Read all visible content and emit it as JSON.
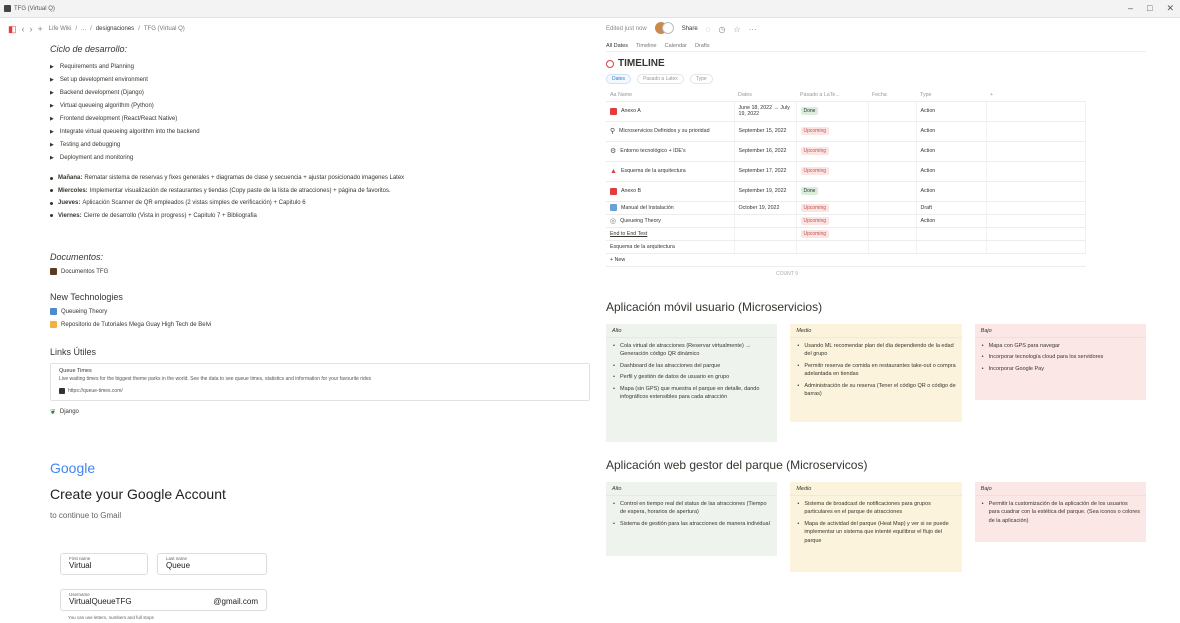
{
  "window": {
    "title": "TFG (Virtual Q)"
  },
  "topbar": {
    "breadcrumb": [
      "Life Wiki",
      "...",
      "designaciones",
      "TFG (Virtual Q)"
    ],
    "edited": "Edited just now",
    "share": "Share"
  },
  "left": {
    "ciclo_title": "Ciclo de desarrollo:",
    "ciclo_items": [
      "Requirements and Planning",
      "Set up development environment",
      "Backend development (Django)",
      "Virtual queueing algorithm (Python)",
      "Frontend development (React/React Native)",
      "Integrate virtual queueing algorithm into the backend",
      "Testing and debugging",
      "Deployment and monitoring"
    ],
    "plan": [
      {
        "day": "Mañana:",
        "text": "Rematar sistema de reservas y fixes generales + diagramas de clase y secuencia + ajustar posicionado imagenes Latex"
      },
      {
        "day": "Miercoles:",
        "text": "Implementar visualización de restaurantes y tiendas (Copy paste de la lista de atracciones) + página de favoritos."
      },
      {
        "day": "Jueves:",
        "text": "Aplicación Scanner de QR empleados (2 vistas simples de verificación) + Capitulo 6"
      },
      {
        "day": "Viernes:",
        "text": "Cierre de desarrollo (Vista in progress) + Capitulo 7 + Bibliografia"
      }
    ],
    "documentos_title": "Documentos:",
    "documentos_link": "Documentos TFG",
    "newtech_title": "New Technologies",
    "newtech_links": [
      "Queueing Theory",
      "Repositorio de Tutoriales Mega Guay High Tech de Belvi"
    ],
    "links_title": "Links Útiles",
    "bookmark": {
      "title": "Queue Times",
      "desc": "Live waiting times for the biggest theme parks in the world. See the data to see queue times, statistics and information for your favourite rides",
      "url": "https://queue-times.com/"
    },
    "django_link": "Django"
  },
  "google": {
    "logo": "Google",
    "title": "Create your Google Account",
    "subtitle": "to continue to Gmail",
    "first_name_label": "First name",
    "first_name": "Virtual",
    "last_name_label": "Last name",
    "last_name": "Queue",
    "username_label": "Username",
    "username": "VirtualQueueTFG",
    "domain": "@gmail.com",
    "hint": "You can use letters, numbers and full stops"
  },
  "right": {
    "views": [
      "All Dates",
      "Timeline",
      "Calendar",
      "Drafts"
    ],
    "timeline_title": "TIMELINE",
    "filters": [
      "Dates",
      "Pasado a Latex",
      "Type"
    ],
    "columns": [
      "Aa Name",
      "Dates",
      "Pasado a LaTe...",
      "Fecha",
      "Type",
      "+"
    ],
    "rows": [
      {
        "name": "Anexo A",
        "dates": "June 18, 2022 → July 19, 2022",
        "status": "Done",
        "type": "Action",
        "icon": "red"
      },
      {
        "name": "Microservicios Definidos y su prioridad",
        "dates": "September 15, 2022",
        "status": "Upcoming",
        "type": "Action",
        "icon": "search"
      },
      {
        "name": "Entorno tecnológico + IDE's",
        "dates": "September 16, 2022",
        "status": "Upcoming",
        "type": "Action",
        "icon": "gear"
      },
      {
        "name": "Esquema de la arquitectura",
        "dates": "September 17, 2022",
        "status": "Upcoming",
        "type": "Action",
        "icon": "triangle"
      },
      {
        "name": "Anexo B",
        "dates": "September 19, 2022",
        "status": "Done",
        "type": "Action",
        "icon": "red"
      },
      {
        "name": "Manual del Instalación",
        "dates": "October 19, 2022",
        "status": "Upcoming",
        "type": "Draft",
        "icon": "doc"
      },
      {
        "name": "Queueing Theory",
        "dates": "",
        "status": "Upcoming",
        "type": "Action",
        "icon": "circle"
      },
      {
        "name": "End to End Test",
        "dates": "",
        "status": "Upcoming",
        "type": "",
        "icon": ""
      },
      {
        "name": "Esquema de la arquitectura",
        "dates": "",
        "status": "",
        "type": "",
        "icon": ""
      }
    ],
    "new_label": "+ New",
    "count_label": "COUNT 9",
    "movil_title": "Aplicación móvil usuario (Microservicios)",
    "movil": {
      "alto": {
        "head": "Alto",
        "items": [
          "Cola virtual de atracciones (Reservar virtualmente) → Generación código QR dinámico",
          "Dashboard de las atracciones del parque",
          "Perfil y gestión de datos de usuario en grupo",
          "Mapa (sin GPS) que muestra el parque en detalle, dando infográficos extensibles para cada atracción"
        ]
      },
      "medio": {
        "head": "Medio",
        "items": [
          "Usando ML recomendar plan del día dependiendo de la edad del grupo",
          "Permitir reserva de comida en restaurantes take-out o compra adelantada en tiendas",
          "Administración de su reserva (Tener el código QR o código de barras)"
        ]
      },
      "bajo": {
        "head": "Bajo",
        "items": [
          "Mapa con GPS para navegar",
          "Incorporar tecnología cloud para los servidores",
          "Incorporar Google Pay"
        ]
      }
    },
    "web_title": "Aplicación web gestor del parque (Microservicos)",
    "web": {
      "alto": {
        "head": "Alto",
        "items": [
          "Control en tiempo real del status de las atracciones (Tiempo de espera, horarios de apertura)",
          "Sistema de gestión para las atracciones de manera individual"
        ]
      },
      "medio": {
        "head": "Medio",
        "items": [
          "Sistema de broadcast de notificaciones para grupos particulares en el parque de atracciones",
          "Mapa de actividad del parque (Heat Map) y ver si se puede implementar un sistema que intenté equilibrar el flujo del parque"
        ]
      },
      "bajo": {
        "head": "Bajo",
        "items": [
          "Permitir la customización de la aplicación de los usuarios para cuadrar con la estética del parque. (Sea iconos o colores de la aplicación)"
        ]
      }
    }
  }
}
